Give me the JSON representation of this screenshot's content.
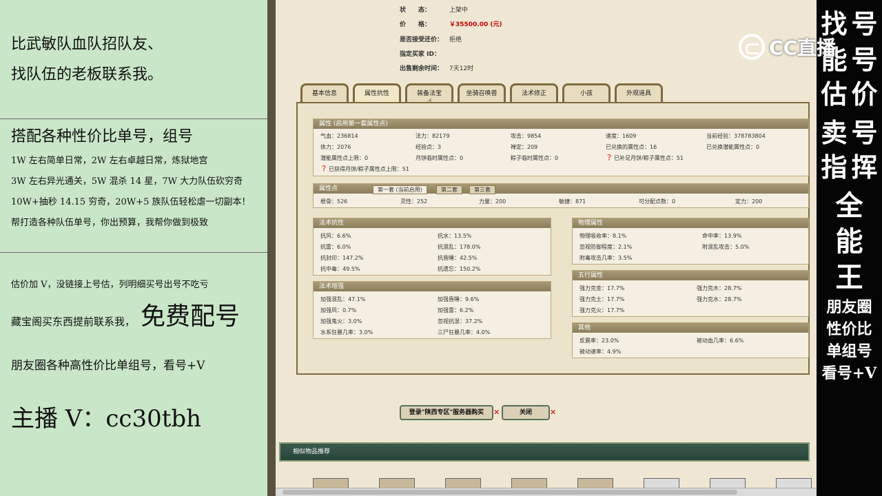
{
  "left": {
    "line1": "比武敏队血队招队友、",
    "line2": "找队伍的老板联系我。",
    "heading": "搭配各种性价比单号，组号",
    "deals": [
      "1W 左右简单日常，2W 左右卓越日常，炼狱地宫",
      "3W 左右异光通关，5W 混杀 14 星，7W 大力队伍砍穷奇",
      "10W+抽秒 14.15 穷奇，20W+5 族队伍轻松虐一切副本！",
      "帮打造各种队伍单号，你出预算，我帮你做到极致"
    ],
    "appraise": "估价加 V，没链接上号估，列明细买号出号不吃亏",
    "cangbao": "藏宝阁买东西提前联系我，",
    "free": "免费配号",
    "moments": "朋友圈各种高性价比单组号，看号+V",
    "streamer": "主播 V：cc30tbh"
  },
  "right": {
    "vertical": [
      "找",
      "号",
      "号",
      "价",
      "号",
      "挥",
      "全",
      "能",
      "王"
    ],
    "vertical_left": [
      "找",
      "能",
      "估",
      "卖",
      "指"
    ],
    "bottom_lines": [
      "朋友圈",
      "性价比",
      "单组号",
      "看号+V"
    ]
  },
  "logo": {
    "text": "CC直播"
  },
  "info": [
    {
      "k": "状　　态：",
      "v": "上架中",
      "color": "#333333"
    },
    {
      "k": "价　　格：",
      "v": "￥35500.00 (元)",
      "color": "#cc0000"
    },
    {
      "k": "是否接受还价：",
      "v": "拒绝",
      "color": "#333333"
    },
    {
      "k": "指定买家 ID：",
      "v": "",
      "color": "#333333"
    },
    {
      "k": "出售剩余时间：",
      "v": "7天12时",
      "color": "#333333"
    }
  ],
  "tabs": [
    "基本信息",
    "属性抗性",
    "装备法宝",
    "坐骑召唤兽",
    "法术修正",
    "小孩",
    "外观道具"
  ],
  "attr": {
    "header": "属性 (启用第一套属性点)",
    "rows": [
      [
        "气血：236814",
        "法力：82179",
        "攻击：9854",
        "速度：1609",
        "当前经验：378783804"
      ],
      [
        "体力：2076",
        "经验点：3",
        "禅定：209",
        "已兑换的属性点：16",
        "已兑换潜能属性点：0"
      ],
      [
        "潜能属性点上限：0",
        "月饼临时属性点：0",
        "粽子临时属性点：0",
        "已补足月饼/粽子属性点：51"
      ],
      [
        "已获得月饼/粽子属性点上限：51"
      ]
    ]
  },
  "points": {
    "header": "属性点",
    "subtabs": [
      "第一套 (当前启用)",
      "第二套",
      "第三套"
    ],
    "values": [
      "根骨：526",
      "灵性：252",
      "力量：200",
      "敏捷：871",
      "可分配点数：0",
      "定力：200"
    ]
  },
  "resist": {
    "header": "法术抗性",
    "rows": [
      [
        "抗风：6.6%",
        "抗水：13.5%"
      ],
      [
        "抗雷：6.0%",
        "抗混乱：178.0%"
      ],
      [
        "抗封印：147.2%",
        "抗昏睡：42.5%"
      ],
      [
        "抗中毒：49.5%",
        "抗遗忘：150.2%"
      ]
    ]
  },
  "enhance": {
    "header": "法术增强",
    "rows": [
      [
        "加强混乱：47.1%",
        "加强昏睡：9.6%"
      ],
      [
        "加强风：0.7%",
        "加强雷：6.2%"
      ],
      [
        "加强鬼火：3.0%",
        "忽视抗混：37.2%"
      ],
      [
        "水系狂暴几率：3.0%",
        "三尸狂暴几率：4.0%"
      ]
    ]
  },
  "physical": {
    "header": "物理属性",
    "rows": [
      [
        "物理吸收率：8.1%",
        "命中率：13.9%"
      ],
      [
        "忽视防御程度：2.1%",
        "附混乱攻击：5.0%"
      ],
      [
        "附毒攻击几率：3.5%",
        ""
      ]
    ]
  },
  "wuxing": {
    "header": "五行属性",
    "rows": [
      [
        "强力克金：17.7%",
        "强力克木：28.7%"
      ],
      [
        "强力克土：17.7%",
        "强力克水：28.7%"
      ],
      [
        "强力克火：17.7%",
        ""
      ]
    ]
  },
  "other": {
    "header": "其他",
    "rows": [
      [
        "反震率：23.0%",
        "被动血几率：6.6%"
      ],
      [
        "被动速率：4.9%",
        ""
      ]
    ]
  },
  "buttons": {
    "login": "登录\"陕西专区\"服务器购买",
    "close": "关闭"
  },
  "similar": {
    "title": "相似物品推荐"
  }
}
